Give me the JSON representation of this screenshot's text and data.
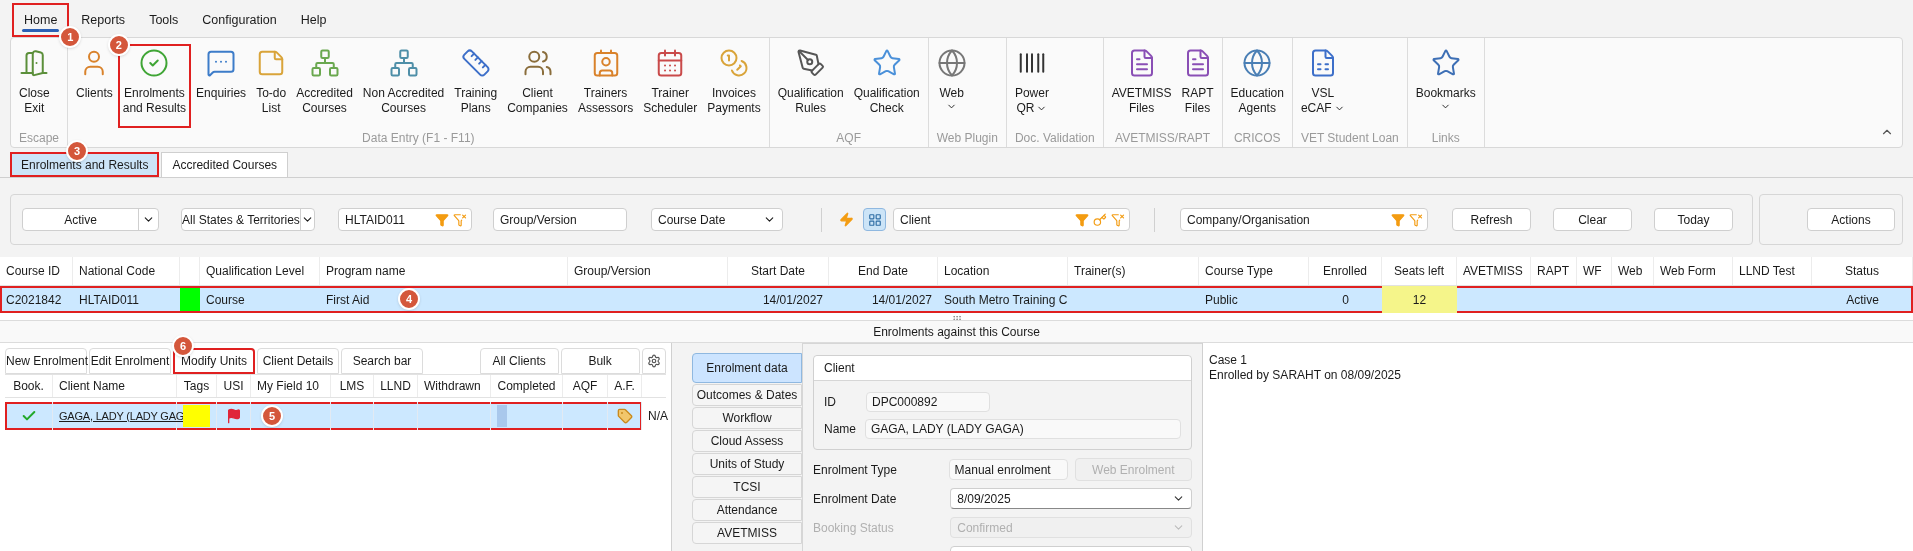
{
  "menu": [
    {
      "label": "Home",
      "selected": true,
      "callout": "1"
    },
    {
      "label": "Reports",
      "selected": false
    },
    {
      "label": "Tools",
      "selected": false
    },
    {
      "label": "Configuration",
      "selected": false
    },
    {
      "label": "Help",
      "selected": false
    }
  ],
  "ribbon": [
    {
      "label": "Escape",
      "buttons": [
        {
          "label": "Close\nExit"
        }
      ]
    },
    {
      "label": "Data Entry (F1 - F11)",
      "buttons": [
        {
          "label": "Clients"
        },
        {
          "label": "Enrolments\nand Results",
          "callout": "2"
        },
        {
          "label": "Enquiries"
        },
        {
          "label": "To-do\nList"
        },
        {
          "label": "Accredited\nCourses"
        },
        {
          "label": "Non Accredited\nCourses"
        },
        {
          "label": "Training\nPlans"
        },
        {
          "label": "Client\nCompanies"
        },
        {
          "label": "Trainers\nAssessors"
        },
        {
          "label": "Trainer\nScheduler"
        },
        {
          "label": "Invoices\nPayments"
        }
      ]
    },
    {
      "label": "AQF",
      "buttons": [
        {
          "label": "Qualification\nRules"
        },
        {
          "label": "Qualification\nCheck"
        }
      ]
    },
    {
      "label": "Web Plugin",
      "buttons": [
        {
          "label": "Web",
          "dropdown": true
        }
      ]
    },
    {
      "label": "Doc. Validation",
      "buttons": [
        {
          "label": "Power\nQR",
          "dropdown": true
        }
      ]
    },
    {
      "label": "AVETMISS/RAPT",
      "buttons": [
        {
          "label": "AVETMISS\nFiles"
        },
        {
          "label": "RAPT\nFiles"
        }
      ]
    },
    {
      "label": "CRICOS",
      "buttons": [
        {
          "label": "Education\nAgents"
        }
      ]
    },
    {
      "label": "VET Student Loan",
      "buttons": [
        {
          "label": "VSL\neCAF",
          "dropdown": true
        }
      ]
    },
    {
      "label": "Links",
      "buttons": [
        {
          "label": "Bookmarks",
          "dropdown": true
        }
      ]
    }
  ],
  "tabs": [
    {
      "label": "Enrolments and Results",
      "selected": true,
      "callout": "3"
    },
    {
      "label": "Accredited Courses",
      "selected": false
    }
  ],
  "filters": [
    {
      "kind": "combo",
      "value": "Active"
    },
    {
      "kind": "combo",
      "value": "All States & Territories"
    },
    {
      "kind": "search",
      "value": "HLTAID011"
    },
    {
      "kind": "text",
      "placeholder": "Group/Version"
    },
    {
      "kind": "select",
      "value": "Course Date"
    }
  ],
  "quick_buttons": [
    {
      "selected": false
    },
    {
      "selected": true
    }
  ],
  "searches": [
    {
      "kind": "search_key",
      "placeholder": "Client"
    },
    {
      "kind": "search",
      "placeholder": "Company/Organisation"
    }
  ],
  "filter_buttons": [
    "Refresh",
    "Clear",
    "Today"
  ],
  "actions_button": "Actions",
  "courses": {
    "columns": [
      "Course ID",
      "National Code",
      null,
      "Qualification Level",
      "Program name",
      "Group/Version",
      "Start Date",
      "End Date",
      "Location",
      "Trainer(s)",
      "Course Type",
      "Enrolled",
      "Seats left",
      "AVETMISS",
      "RAPT",
      "WF",
      "Web",
      "Web Form",
      "LLND Test",
      "Status"
    ],
    "rows": [
      {
        "selected": true,
        "outlined": true,
        "cells": [
          "C2021842",
          "HLTAID011",
          {
            "kind": "swatch",
            "color": "#00ff00"
          },
          "Course",
          {
            "text": "First Aid",
            "callout": "4"
          },
          null,
          "14/01/2027",
          "14/01/2027",
          "South Metro Training C",
          null,
          "Public",
          "0",
          {
            "text": "12",
            "highlight": true
          },
          null,
          null,
          null,
          null,
          null,
          null,
          "Active"
        ]
      }
    ]
  },
  "section_title": "Enrolments against this Course",
  "enrol_buttons_left": [
    {
      "label": "New Enrolment"
    },
    {
      "label": "Edit Enrolment"
    },
    {
      "label": "Modify Units",
      "callout": "6"
    },
    {
      "label": "Client Details"
    },
    {
      "label": "Search bar"
    }
  ],
  "enrol_buttons_right": [
    {
      "label": "All Clients"
    },
    {
      "label": "Bulk"
    }
  ],
  "enrolments": {
    "columns": [
      "Book.",
      "Client Name",
      "Tags",
      "USI",
      "My Field 10",
      "LMS",
      "LLND",
      "Withdrawn",
      "Completed",
      "AQF",
      "A.F."
    ],
    "rows": [
      {
        "selected": true,
        "outlined": true,
        "trailing": "N/A",
        "cells": [
          {
            "kind": "check"
          },
          {
            "kind": "link",
            "text": "GAGA, LADY (LADY GAG"
          },
          {
            "kind": "swatch",
            "color": "#ffff00"
          },
          {
            "kind": "flag"
          },
          {
            "kind": "callout",
            "callout": "5"
          },
          null,
          null,
          null,
          {
            "kind": "bar",
            "color": "#a9c8ec"
          },
          null,
          {
            "kind": "tag"
          }
        ]
      }
    ]
  },
  "side_tabs": [
    {
      "label": "Enrolment data",
      "selected": true
    },
    {
      "label": "Outcomes & Dates",
      "selected": false
    },
    {
      "label": "Workflow",
      "selected": false
    },
    {
      "label": "Cloud Assess",
      "selected": false
    },
    {
      "label": "Units of Study",
      "selected": false
    },
    {
      "label": "TCSI",
      "selected": false
    },
    {
      "label": "Attendance",
      "selected": false
    },
    {
      "label": "AVETMISS",
      "selected": false
    }
  ],
  "client_box": {
    "title": "Client",
    "id_label": "ID",
    "id": "DPC000892",
    "name_label": "Name",
    "name": "GAGA, LADY (LADY GAGA)"
  },
  "fields": [
    {
      "kind": "text",
      "label": "Enrolment Type",
      "value": "Manual enrolment",
      "disabled": false,
      "button": {
        "label": "Web Enrolment",
        "disabled": true
      }
    },
    {
      "kind": "select",
      "label": "Enrolment Date",
      "value": "8/09/2025",
      "disabled": false
    },
    {
      "kind": "select",
      "label": "Booking Status",
      "value": "Confirmed",
      "disabled": true
    },
    {
      "kind": "blank"
    }
  ],
  "notes": [
    "Case 1",
    "Enrolled by SARAHT on 08/09/2025"
  ]
}
